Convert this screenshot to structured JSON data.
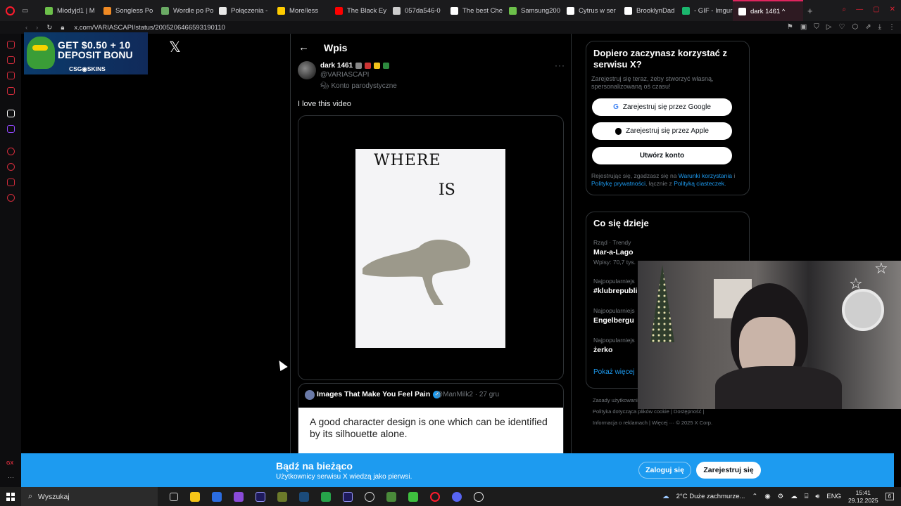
{
  "browser": {
    "tabs": [
      {
        "label": "Miodyjd1 | M",
        "color": "#6cc04a"
      },
      {
        "label": "Songless Po",
        "color": "#f08a24"
      },
      {
        "label": "Wordle po Po",
        "color": "#6aaa64"
      },
      {
        "label": "Połączenia -",
        "color": "#e8e8e8"
      },
      {
        "label": "More/less",
        "color": "#ffcc00"
      },
      {
        "label": "The Black Ey",
        "color": "#ff0000"
      },
      {
        "label": "057da546-0",
        "color": "#cccccc"
      },
      {
        "label": "The best Che",
        "color": "#ffffff"
      },
      {
        "label": "Samsung200",
        "color": "#6cc04a"
      },
      {
        "label": "Cytrus w ser",
        "color": "#ffffff"
      },
      {
        "label": "BrooklynDad",
        "color": "#ffffff"
      },
      {
        "label": "- GIF - Imgur",
        "color": "#1bb76e"
      },
      {
        "label": "dark 1461 ^",
        "color": "#ffffff",
        "active": true
      }
    ],
    "url": "x.com/VARIASCAPI/status/2005206466593190110"
  },
  "ad": {
    "line1": "GET $0.50 + 10",
    "line2": "DEPOSIT BONU",
    "brand": "CSG◉SKINS"
  },
  "x_logo": "𝕏",
  "post": {
    "header_title": "Wpis",
    "back_icon": "←",
    "author_name": "dark 1461",
    "author_handle": "@VARIASCAPI",
    "parody_label": "Konto parodystyczne",
    "more_icon": "···",
    "text": "I love this video",
    "image_word1": "WHERE",
    "image_word2": "IS",
    "quote": {
      "name": "Images That Make You Feel Pain",
      "handle_date": "@ManMilk2 · 27 gru",
      "image_text": "A good character design is one which can be identified by its silhouette alone."
    }
  },
  "signup": {
    "title": "Dopiero zaczynasz korzystać z serwisu X?",
    "subtitle": "Zarejestruj się teraz, żeby stworzyć własną, spersonalizowaną oś czasu!",
    "google_btn": "Zarejestruj się przez Google",
    "apple_btn": "Zarejestruj się przez Apple",
    "create_btn": "Utwórz konto",
    "legal_prefix": "Rejestrując się, zgadzasz się na",
    "legal_terms": "Warunki korzystania",
    "legal_and": "i",
    "legal_privacy": "Politykę prywatności",
    "legal_mid": ", łącznie z",
    "legal_cookies": "Polityką ciasteczek."
  },
  "trends": {
    "title": "Co się dzieje",
    "items": [
      {
        "category": "Rząd · Trendy",
        "name": "Mar-a-Lago",
        "count": "Wpisy: 70,7 tys."
      },
      {
        "category": "Najpopularniejs",
        "name": "#klubrepubli",
        "count": ""
      },
      {
        "category": "Najpopularniejs",
        "name": "Engelbergu",
        "count": ""
      },
      {
        "category": "Najpopularniejs",
        "name": "żerko",
        "count": ""
      }
    ],
    "show_more": "Pokaż więcej"
  },
  "footer": {
    "line1": "Zasady użytkowani",
    "line2": "Polityka dotycząca plików cookie  |  Dostępność  |",
    "line3": "Informacja o reklamach  |  Więcej ···  © 2025 X Corp."
  },
  "banner": {
    "title": "Bądź na bieżąco",
    "subtitle": "Użytkownicy serwisu X wiedzą jako pierwsi.",
    "login": "Zaloguj się",
    "register": "Zarejestruj się"
  },
  "taskbar": {
    "search_placeholder": "Wyszukaj",
    "weather": "2°C  Duże zachmurze...",
    "lang": "ENG",
    "time": "15:41",
    "date": "29.12.2025",
    "notif_count": "6"
  },
  "colors": {
    "accent": "#1d9bf0",
    "opera": "#ff1b2d"
  }
}
